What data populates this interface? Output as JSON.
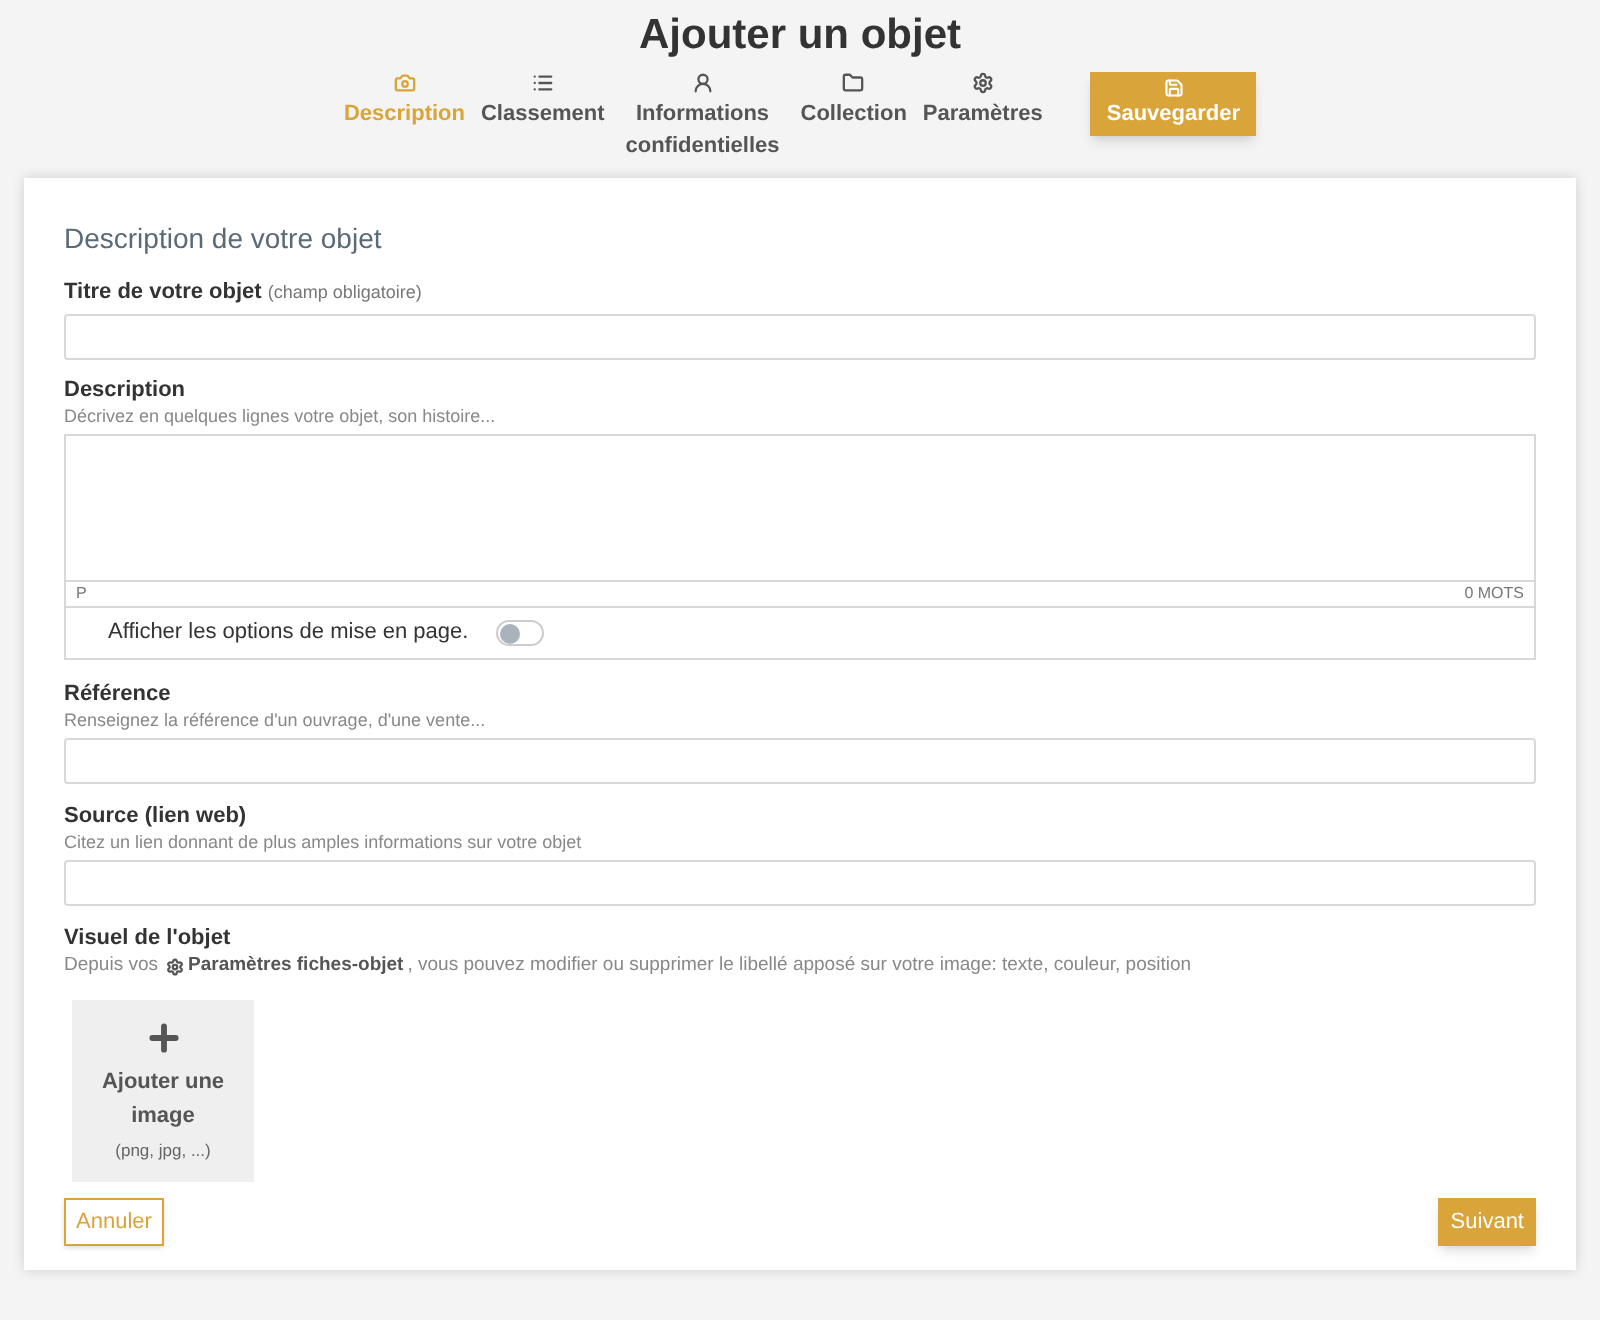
{
  "page_title": "Ajouter un objet",
  "tabs": [
    {
      "kind": "camera",
      "label": "Description",
      "selected": true
    },
    {
      "kind": "list",
      "label": "Classement",
      "selected": false
    },
    {
      "kind": "secret",
      "label": "Informations confidentielles",
      "selected": false
    },
    {
      "kind": "folder",
      "label": "Collection",
      "selected": false
    },
    {
      "kind": "gear",
      "label": "Paramètres",
      "selected": false
    }
  ],
  "save_button": "Sauvegarder",
  "section_title": "Description de votre objet",
  "title_field": {
    "label": "Titre de votre objet",
    "note": "(champ obligatoire)"
  },
  "description_field": {
    "label": "Description",
    "hint": "Décrivez en quelques lignes votre objet, son histoire...",
    "path": "P",
    "word_count": "0 MOTS"
  },
  "layout_toggle": {
    "label": "Afficher les options de mise en page.",
    "on": false
  },
  "reference_field": {
    "label": "Référence",
    "hint": "Renseignez la référence d'un ouvrage, d'une vente..."
  },
  "source_field": {
    "label": "Source (lien web)",
    "hint": "Citez un lien donnant de plus amples informations sur votre objet"
  },
  "visual": {
    "label": "Visuel de l'objet",
    "hint_before": "Depuis vos",
    "hint_link": "Paramètres fiches-objet",
    "hint_after": ", vous pouvez modifier ou supprimer le libellé apposé sur votre image: texte, couleur, position",
    "add_title": "Ajouter une image",
    "add_formats": "(png, jpg, ...)"
  },
  "buttons": {
    "cancel": "Annuler",
    "next": "Suivant"
  }
}
